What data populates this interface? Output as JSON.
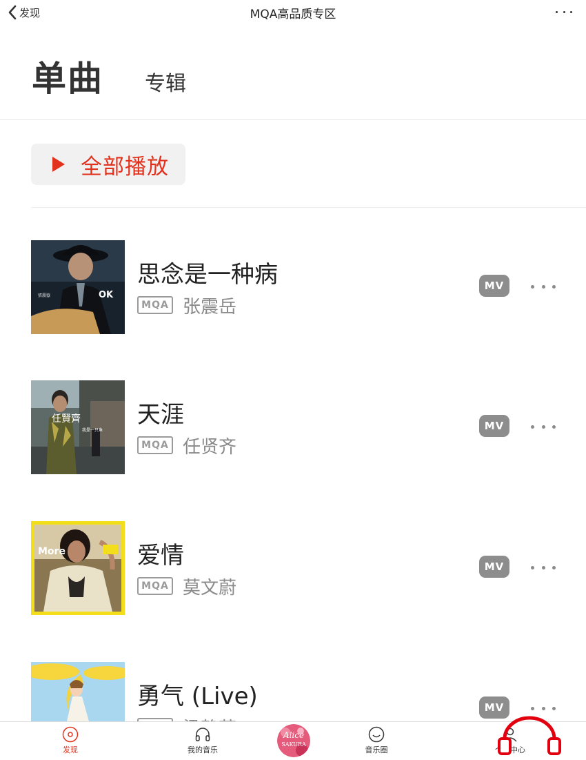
{
  "nav": {
    "back_label": "发现",
    "title": "MQA高品质专区"
  },
  "tabs": {
    "active": "单曲",
    "other": "专辑"
  },
  "play_all": {
    "label": "全部播放"
  },
  "songs": [
    {
      "title": "思念是一种病",
      "quality": "MQA",
      "artist": "张震岳",
      "mv": "MV"
    },
    {
      "title": "天涯",
      "quality": "MQA",
      "artist": "任贤齐",
      "mv": "MV"
    },
    {
      "title": "爱情",
      "quality": "MQA",
      "artist": "莫文蔚",
      "mv": "MV"
    },
    {
      "title": "勇气 (Live)",
      "quality": "MQA",
      "artist": "梁静茹",
      "mv": "MV"
    }
  ],
  "tabbar": {
    "items": [
      {
        "label": "发现",
        "icon": "disc-icon",
        "active": true
      },
      {
        "label": "我的音乐",
        "icon": "headphones-icon",
        "active": false
      },
      {
        "label": "音乐圈",
        "icon": "smile-icon",
        "active": false
      },
      {
        "label": "个人中心",
        "icon": "person-icon",
        "active": false
      }
    ],
    "avatar_text": [
      "Alice",
      "SAKURA"
    ]
  },
  "colors": {
    "accent": "#e2321d",
    "muted": "#8a8a8a",
    "badge_bg": "#8d8d8d"
  }
}
